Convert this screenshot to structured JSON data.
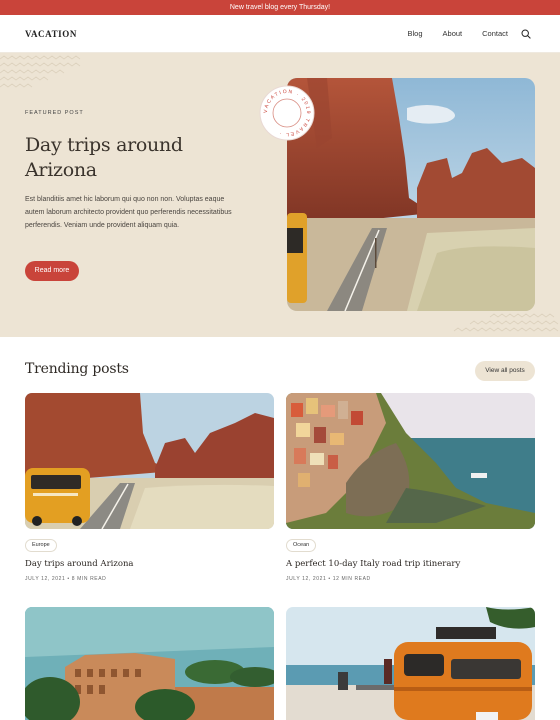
{
  "announcement": "New travel blog every Thursday!",
  "header": {
    "logo": "VACATION",
    "nav": [
      "Blog",
      "About",
      "Contact"
    ]
  },
  "hero": {
    "label": "FEATURED POST",
    "title": "Day trips around Arizona",
    "description": "Est blanditiis amet hic laborum qui quo non non. Voluptas eaque autem laborum architecto provident quo perferendis necessitatibus perferendis. Veniam unde provident aliquam quia.",
    "button": "Read more",
    "badge_text": "VACATION · 2019 TRAVEL ·"
  },
  "trending": {
    "title": "Trending posts",
    "view_all": "View all posts",
    "posts": [
      {
        "tag": "Europe",
        "title": "Day trips around Arizona",
        "date": "JULY 12, 2021",
        "read": "8 MIN READ"
      },
      {
        "tag": "Ocean",
        "title": "A perfect 10-day Italy road trip itinerary",
        "date": "JULY 12, 2021",
        "read": "12 MIN READ"
      }
    ]
  },
  "colors": {
    "accent": "#c9443a",
    "sand": "#ede4d4"
  }
}
